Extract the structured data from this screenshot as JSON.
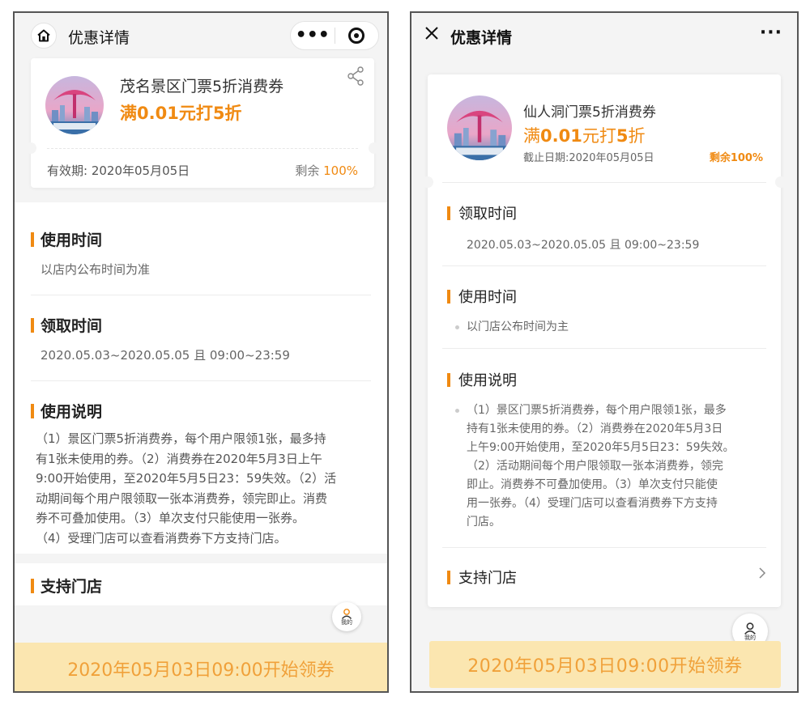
{
  "left": {
    "nav": {
      "title": "优惠详情",
      "more": "•••"
    },
    "coupon": {
      "name": "茂名景区门票5折消费券",
      "price": "满0.01元打5折",
      "validity": "有效期: 2020年05月05日",
      "remain_label": "剩余",
      "remain_value": "100%"
    },
    "sections": {
      "use_time": {
        "title": "使用时间",
        "text": "以店内公布时间为准"
      },
      "claim_time": {
        "title": "领取时间",
        "text": "2020.05.03~2020.05.05 且 09:00~23:59"
      },
      "instructions": {
        "title": "使用说明",
        "lines": [
          "（1）景区门票5折消费券，每个用户限领1张，最多持",
          "有1张未使用的券。（2）消费券在2020年5月3日上午",
          "9:00开始使用，至2020年5月5日23：59失效。（2）活",
          "动期间每个用户限领取一张本消费券，领完即止。消费",
          "券不可叠加使用。（3）单次支付只能使用一张券。",
          "（4）受理门店可以查看消费券下方支持门店。"
        ]
      },
      "stores": {
        "title": "支持门店"
      }
    },
    "fab_label": "我的",
    "bottom_button": "2020年05月03日09:00开始领券"
  },
  "right": {
    "nav": {
      "title": "优惠详情",
      "more": "···"
    },
    "coupon": {
      "name": "仙人洞门票5折消费券",
      "price_prefix": "满",
      "price_amount": "0.01",
      "price_mid": "元打",
      "price_discount": "5",
      "price_suffix": "折",
      "deadline": "截止日期:2020年05月05日",
      "remain": "剩余100%"
    },
    "sections": {
      "claim_time": {
        "title": "领取时间",
        "text": "2020.05.03~2020.05.05 且 09:00~23:59"
      },
      "use_time": {
        "title": "使用时间",
        "text": "以门店公布时间为主"
      },
      "instructions": {
        "title": "使用说明",
        "lines": [
          "（1）景区门票5折消费券，每个用户限领1张，最多",
          "持有1张未使用的券。（2）消费券在2020年5月3日",
          "上午9:00开始使用，至2020年5月5日23：59失效。",
          "（2）活动期间每个用户限领取一张本消费券，领完",
          "即止。消费券不可叠加使用。（3）单次支付只能使",
          "用一张券。（4）受理门店可以查看消费券下方支持",
          "门店。"
        ]
      },
      "stores": {
        "title": "支持门店"
      }
    },
    "fab_label": "我的",
    "bottom_button": "2020年05月03日09:00开始领券"
  },
  "colors": {
    "accent": "#f08a12",
    "button_bg": "#fbe6b0",
    "button_text": "#f0a13a"
  }
}
